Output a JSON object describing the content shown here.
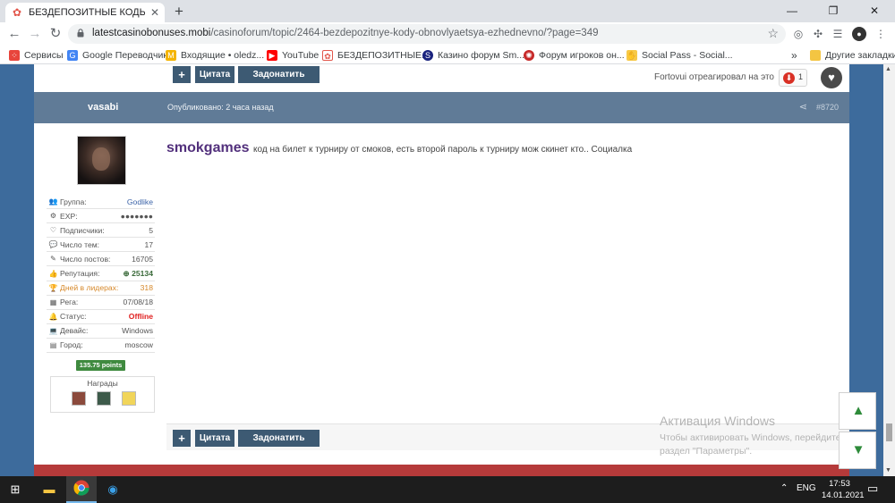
{
  "browser": {
    "tab_title": "БЕЗДЕПОЗИТНЫЕ КОДЫ (Обно",
    "url_host": "latestcasinobonuses.mobi",
    "url_path": "/casinoforum/topic/2464-bezdepozitnye-kody-obnovlyaetsya-ezhednevno/?page=349",
    "bookmarks": [
      {
        "label": "Сервисы",
        "icon": "apps-grid-icon"
      },
      {
        "label": "Google Переводчик",
        "icon": "google-translate-icon"
      },
      {
        "label": "Входящие • oledz...",
        "icon": "gmail-icon"
      },
      {
        "label": "YouTube",
        "icon": "youtube-icon"
      },
      {
        "label": "БЕЗДЕПОЗИТНЫЕ...",
        "icon": "casino-forum-icon"
      },
      {
        "label": "Казино форум Sm...",
        "icon": "sm-forum-icon"
      },
      {
        "label": "Форум игроков он...",
        "icon": "players-forum-icon"
      },
      {
        "label": "Social Pass - Social...",
        "icon": "social-pass-icon"
      }
    ],
    "bookmarks_more": "»",
    "other_bookmarks": "Другие закладки"
  },
  "forum": {
    "btn_plus": "+",
    "btn_quote": "Цитата",
    "btn_points": "Задонатить Points",
    "reaction_text": "Fortovui отреагировал на это",
    "reaction_count": "1",
    "post": {
      "author": "vasabi",
      "published": "Опубликовано: 2 часа назад",
      "post_number": "#8720",
      "mention": "smokgames",
      "text": "код на билет к турниру от смоков, есть второй пароль к турниру мож скинет кто.. Социалка"
    },
    "profile": [
      {
        "icon": "group-icon",
        "label": "Группа:",
        "value": "Godlike",
        "style": "blue"
      },
      {
        "icon": "exp-icon",
        "label": "EXP:",
        "value": "●●●●●●●",
        "style": ""
      },
      {
        "icon": "heart-outline-icon",
        "label": "Подписчики:",
        "value": "5",
        "style": ""
      },
      {
        "icon": "comments-icon",
        "label": "Число тем:",
        "value": "17",
        "style": ""
      },
      {
        "icon": "edit-icon",
        "label": "Число постов:",
        "value": "16705",
        "style": ""
      },
      {
        "icon": "thumbs-up-icon",
        "label": "Репутация:",
        "value": "25134",
        "style": "green"
      },
      {
        "icon": "trophy-icon",
        "label": "Дней в лидерах:",
        "value": "318",
        "style": "orange"
      },
      {
        "icon": "calendar-icon",
        "label": "Рега:",
        "value": "07/08/18",
        "style": ""
      },
      {
        "icon": "bell-icon",
        "label": "Статус:",
        "value": "Offline",
        "style": "red"
      },
      {
        "icon": "laptop-icon",
        "label": "Девайс:",
        "value": "Windows",
        "style": ""
      },
      {
        "icon": "id-card-icon",
        "label": "Город:",
        "value": "moscow",
        "style": ""
      }
    ],
    "points_badge": "135.75 points",
    "awards_title": "Награды"
  },
  "watermark": {
    "title": "Активация Windows",
    "line1": "Чтобы активировать Windows, перейдите в",
    "line2": "раздел \"Параметры\"."
  },
  "taskbar": {
    "lang": "ENG",
    "time": "17:53",
    "date": "14.01.2021"
  },
  "colors": {
    "page_bg": "#3d6b9c",
    "post_header": "#607b97",
    "button": "#3d5a73",
    "mention": "#52307c",
    "points_badge": "#3f8a3f"
  }
}
